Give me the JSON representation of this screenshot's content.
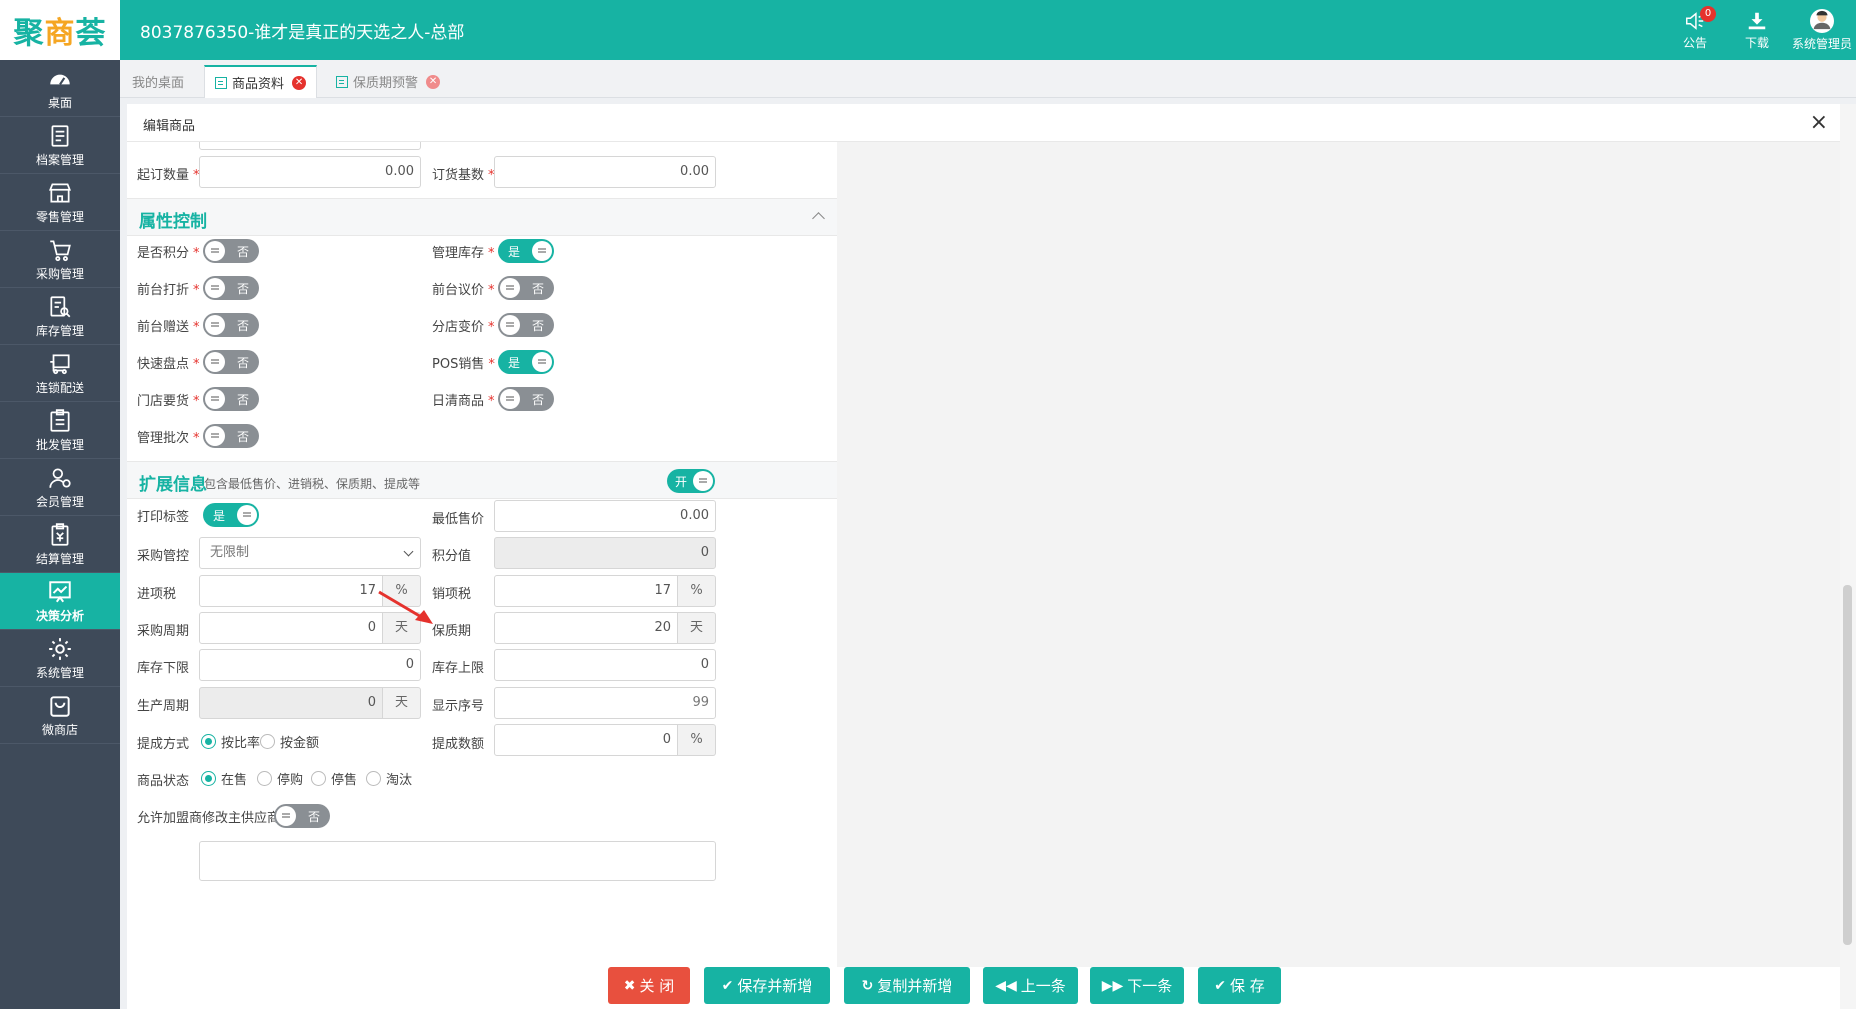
{
  "header": {
    "logo_left": "聚",
    "logo_mid": "商",
    "logo_right": "荟",
    "store_title": "8037876350-谁才是真正的天选之人-总部",
    "announce_label": "公告",
    "announce_badge": "0",
    "download_label": "下载",
    "user_label": "系统管理员"
  },
  "sidebar": {
    "items": [
      {
        "label": "桌面",
        "icon": "dashboard-icon"
      },
      {
        "label": "档案管理",
        "icon": "archive-icon"
      },
      {
        "label": "零售管理",
        "icon": "store-icon"
      },
      {
        "label": "采购管理",
        "icon": "cart-icon"
      },
      {
        "label": "库存管理",
        "icon": "inventory-icon"
      },
      {
        "label": "连锁配送",
        "icon": "delivery-icon"
      },
      {
        "label": "批发管理",
        "icon": "wholesale-icon"
      },
      {
        "label": "会员管理",
        "icon": "member-icon"
      },
      {
        "label": "结算管理",
        "icon": "settlement-icon"
      },
      {
        "label": "决策分析",
        "icon": "analysis-icon"
      },
      {
        "label": "系统管理",
        "icon": "settings-icon"
      },
      {
        "label": "微商店",
        "icon": "shop-bag-icon"
      }
    ],
    "active_index": 9
  },
  "tabs": [
    {
      "label": "我的桌面"
    },
    {
      "label": "商品资料"
    },
    {
      "label": "保质期预警"
    }
  ],
  "panel": {
    "title": "编辑商品",
    "close": "×"
  },
  "order": {
    "min_qty_label": "起订数量",
    "min_qty_value": "0.00",
    "order_base_label": "订货基数",
    "order_base_value": "0.00"
  },
  "attr_section": {
    "title": "属性控制"
  },
  "attrs": [
    {
      "label": "是否积分",
      "state": "否"
    },
    {
      "label": "管理库存",
      "state": "是"
    },
    {
      "label": "前台打折",
      "state": "否"
    },
    {
      "label": "前台议价",
      "state": "否"
    },
    {
      "label": "前台赠送",
      "state": "否"
    },
    {
      "label": "分店变价",
      "state": "否"
    },
    {
      "label": "快速盘点",
      "state": "否"
    },
    {
      "label": "POS销售",
      "state": "是"
    },
    {
      "label": "门店要货",
      "state": "否"
    },
    {
      "label": "日清商品",
      "state": "否"
    },
    {
      "label": "管理批次",
      "state": "否"
    }
  ],
  "ext_section": {
    "title": "扩展信息",
    "subtitle": "包含最低售价、进销税、保质期、提成等",
    "toggle": "开"
  },
  "ext": {
    "print_label": "打印标签",
    "print_state": "是",
    "min_price_label": "最低售价",
    "min_price_value": "0.00",
    "purchase_ctrl_label": "采购管控",
    "purchase_ctrl_value": "无限制",
    "points_label": "积分值",
    "points_value": "0",
    "in_tax_label": "进项税",
    "in_tax_value": "17",
    "in_tax_unit": "%",
    "out_tax_label": "销项税",
    "out_tax_value": "17",
    "out_tax_unit": "%",
    "purchase_cycle_label": "采购周期",
    "purchase_cycle_value": "0",
    "purchase_cycle_unit": "天",
    "shelf_life_label": "保质期",
    "shelf_life_value": "20",
    "shelf_life_unit": "天",
    "stock_min_label": "库存下限",
    "stock_min_value": "0",
    "stock_max_label": "库存上限",
    "stock_max_value": "0",
    "prod_cycle_label": "生产周期",
    "prod_cycle_value": "0",
    "prod_cycle_unit": "天",
    "display_order_label": "显示序号",
    "display_order_value": "99",
    "commission_mode_label": "提成方式",
    "commission_mode_opt1": "按比率",
    "commission_mode_opt2": "按金额",
    "commission_value_label": "提成数额",
    "commission_value": "0",
    "commission_unit": "%",
    "status_label": "商品状态",
    "status_opt1": "在售",
    "status_opt2": "停购",
    "status_opt3": "停售",
    "status_opt4": "淘汰",
    "franchise_label": "允许加盟商修改主供应商",
    "franchise_state": "否"
  },
  "buttons": {
    "close": "关 闭",
    "save_new": "保存并新增",
    "copy_new": "复制并新增",
    "prev": "上一条",
    "next": "下一条",
    "save": "保 存"
  },
  "colors": {
    "accent": "#17b3a3",
    "sidebar": "#3e4a59",
    "danger": "#e8503e"
  }
}
